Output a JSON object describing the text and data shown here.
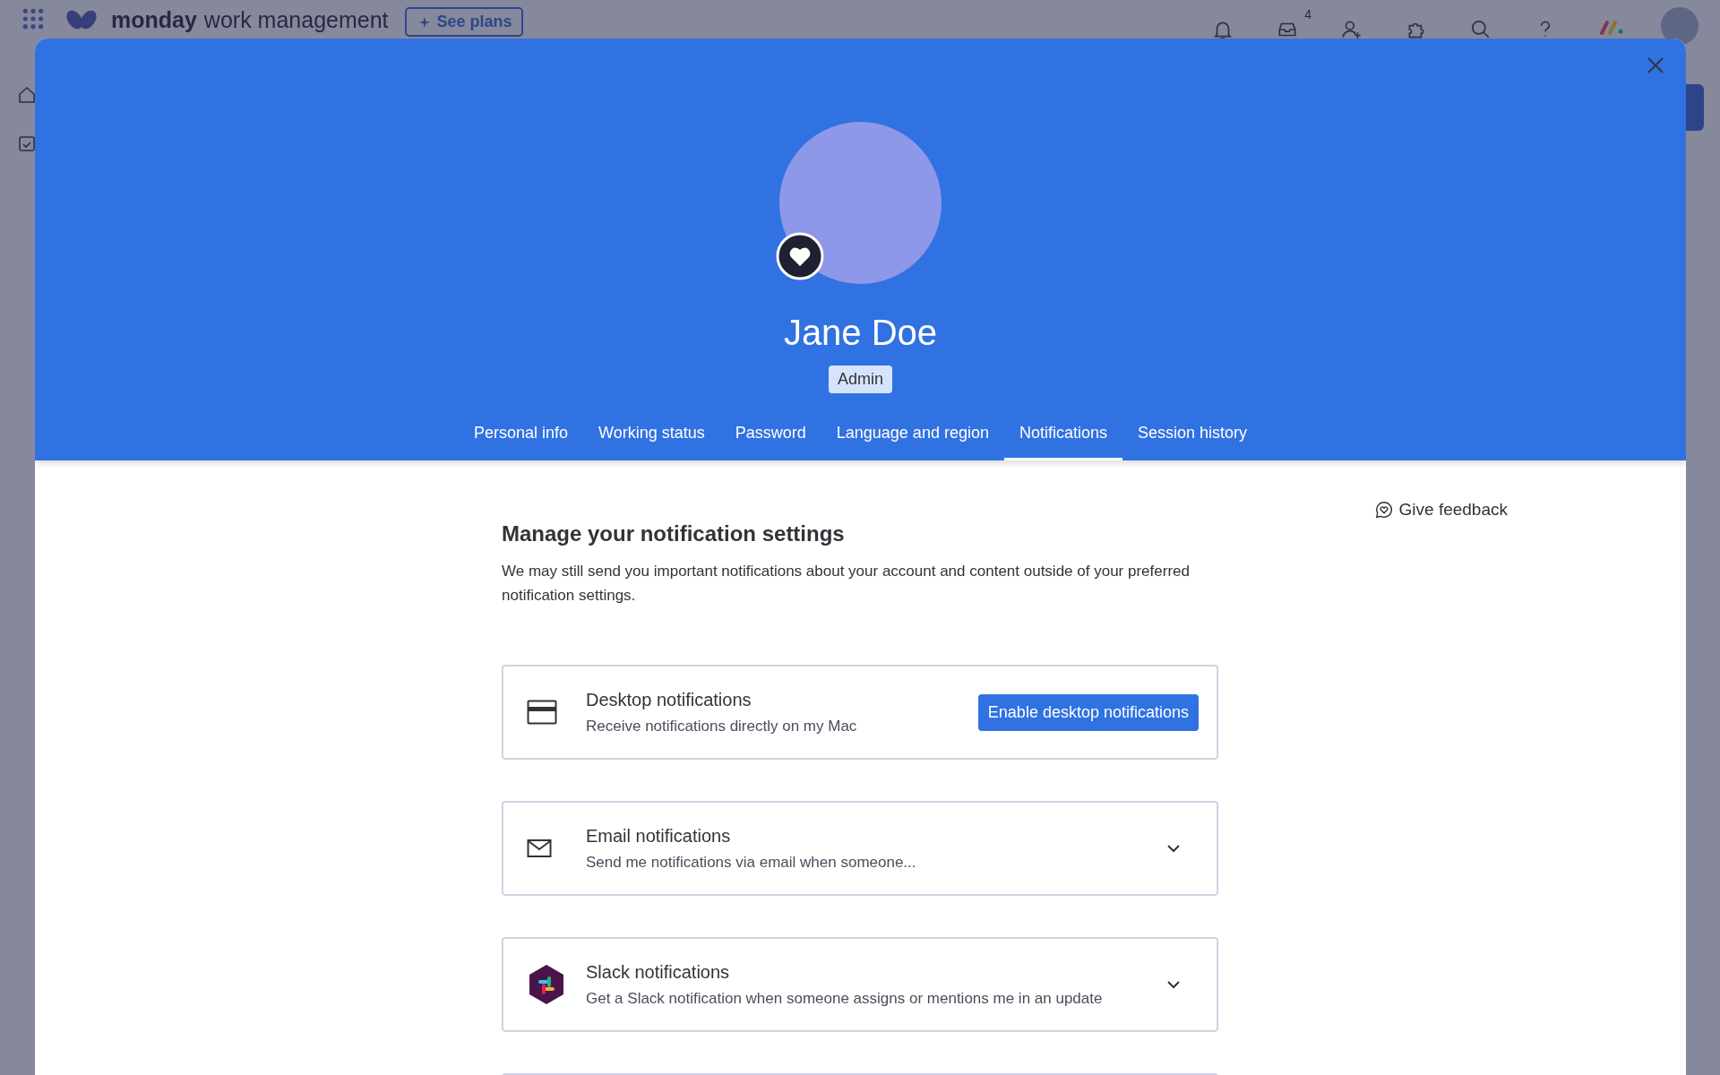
{
  "app_bar": {
    "product_bold": "monday",
    "product_rest": "work management",
    "plans_button": "See plans",
    "inbox_badge": "4"
  },
  "profile": {
    "name": "Jane Doe",
    "role": "Admin"
  },
  "tabs": [
    {
      "label": "Personal info",
      "selected": false
    },
    {
      "label": "Working status",
      "selected": false
    },
    {
      "label": "Password",
      "selected": false
    },
    {
      "label": "Language and region",
      "selected": false
    },
    {
      "label": "Notifications",
      "selected": true
    },
    {
      "label": "Session history",
      "selected": false
    }
  ],
  "feedback_link": "Give feedback",
  "section": {
    "title": "Manage your notification settings",
    "description": "We may still send you important notifications about your account and content outside of your preferred notification settings."
  },
  "channels": [
    {
      "kind": "desktop",
      "title": "Desktop notifications",
      "subtitle": "Receive notifications directly on my Mac",
      "action": "Enable desktop notifications",
      "expandable": false
    },
    {
      "kind": "email",
      "title": "Email notifications",
      "subtitle": "Send me notifications via email when someone...",
      "expandable": true
    },
    {
      "kind": "slack",
      "title": "Slack notifications",
      "subtitle": "Get a Slack notification when someone assigns or mentions me in an update",
      "expandable": true
    }
  ]
}
